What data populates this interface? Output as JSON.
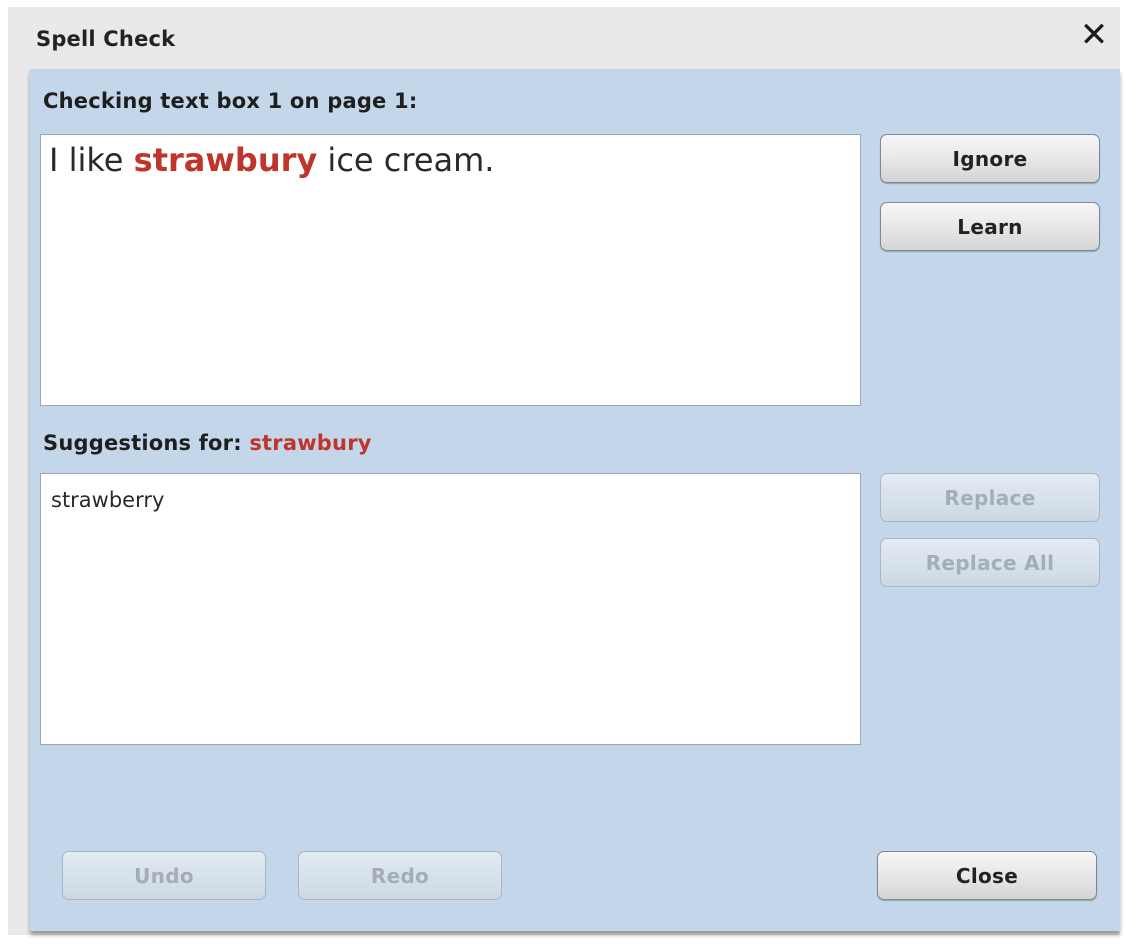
{
  "window": {
    "title": "Spell Check",
    "close_glyph": "✕",
    "close_icon": "close-icon"
  },
  "checking": {
    "label": "Checking text box 1 on page 1:",
    "text_before": "I like ",
    "misspelled_word": "strawbury",
    "text_after": " ice cream."
  },
  "suggestions": {
    "label_prefix": "Suggestions for: ",
    "word": "strawbury",
    "items": [
      "strawberry"
    ]
  },
  "buttons": {
    "ignore": "Ignore",
    "learn": "Learn",
    "replace": "Replace",
    "replace_all": "Replace All",
    "undo": "Undo",
    "redo": "Redo",
    "close": "Close"
  },
  "colors": {
    "panel_bg": "#c4d7ea",
    "misspelled": "#c0352b",
    "disabled_text": "#a5adb5"
  }
}
